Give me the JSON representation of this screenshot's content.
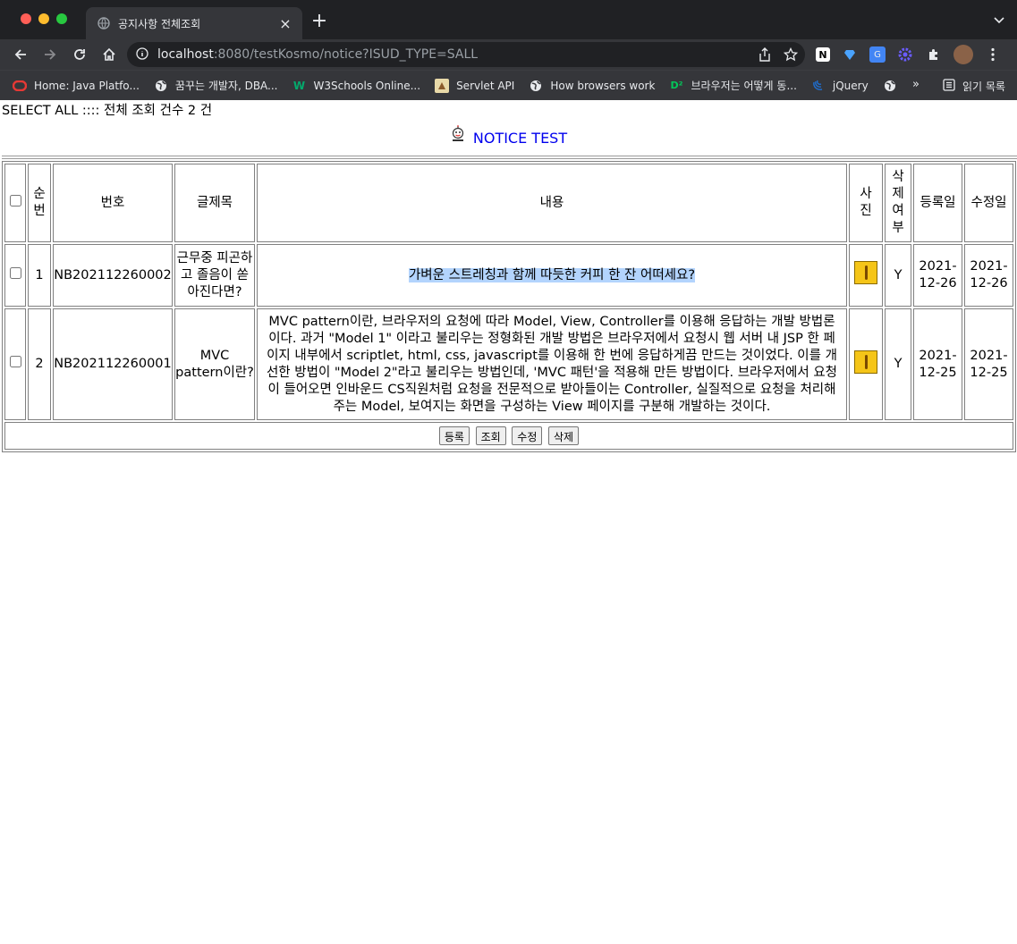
{
  "browser": {
    "tab_title": "공지사항 전체조회",
    "url_host": "localhost",
    "url_rest": ":8080/testKosmo/notice?ISUD_TYPE=SALL",
    "bookmarks": [
      "Home: Java Platfo...",
      "꿈꾸는 개발자, DBA...",
      "W3Schools Online...",
      "Servlet API",
      "How browsers work",
      "브라우저는 어떻게 동...",
      "jQuery"
    ],
    "more": "»",
    "reading_list": "읽기 목록"
  },
  "page": {
    "count_line": "SELECT ALL :::: 전체 조회 건수 2 건",
    "title": "NOTICE TEST",
    "headers": {
      "seq": "순번",
      "no": "번호",
      "subject": "글제목",
      "content": "내용",
      "photo": "사진",
      "deleted": "삭제여부",
      "reg_date": "등록일",
      "mod_date": "수정일"
    },
    "rows": [
      {
        "seq": "1",
        "no": "NB202112260002",
        "subject": "근무중 피곤하고 졸음이 쏟아진다면?",
        "content": "가벼운 스트레칭과 함께 따듯한 커피 한 잔 어떠세요?",
        "deleted": "Y",
        "reg_date": "2021-12-26",
        "mod_date": "2021-12-26"
      },
      {
        "seq": "2",
        "no": "NB202112260001",
        "subject": "MVC pattern이란?",
        "content": "MVC pattern이란, 브라우저의 요청에 따라 Model, View, Controller를 이용해 응답하는 개발 방법론이다. 과거 \"Model 1\" 이라고 불리우는 정형화된 개발 방법은 브라우저에서 요청시 웹 서버 내 JSP 한 페이지 내부에서 scriptlet, html, css, javascript를 이용해 한 번에 응답하게끔 만드는 것이었다. 이를 개선한 방법이 \"Model 2\"라고 불리우는 방법인데, 'MVC 패턴'을 적용해 만든 방법이다. 브라우저에서 요청이 들어오면 인바운드 CS직원처럼 요청을 전문적으로 받아들이는 Controller, 실질적으로 요청을 처리해주는 Model, 보여지는 화면을 구성하는 View 페이지를 구분해 개발하는 것이다.",
        "deleted": "Y",
        "reg_date": "2021-12-25",
        "mod_date": "2021-12-25"
      }
    ],
    "buttons": {
      "insert": "등록",
      "select": "조회",
      "update": "수정",
      "delete": "삭제"
    }
  }
}
